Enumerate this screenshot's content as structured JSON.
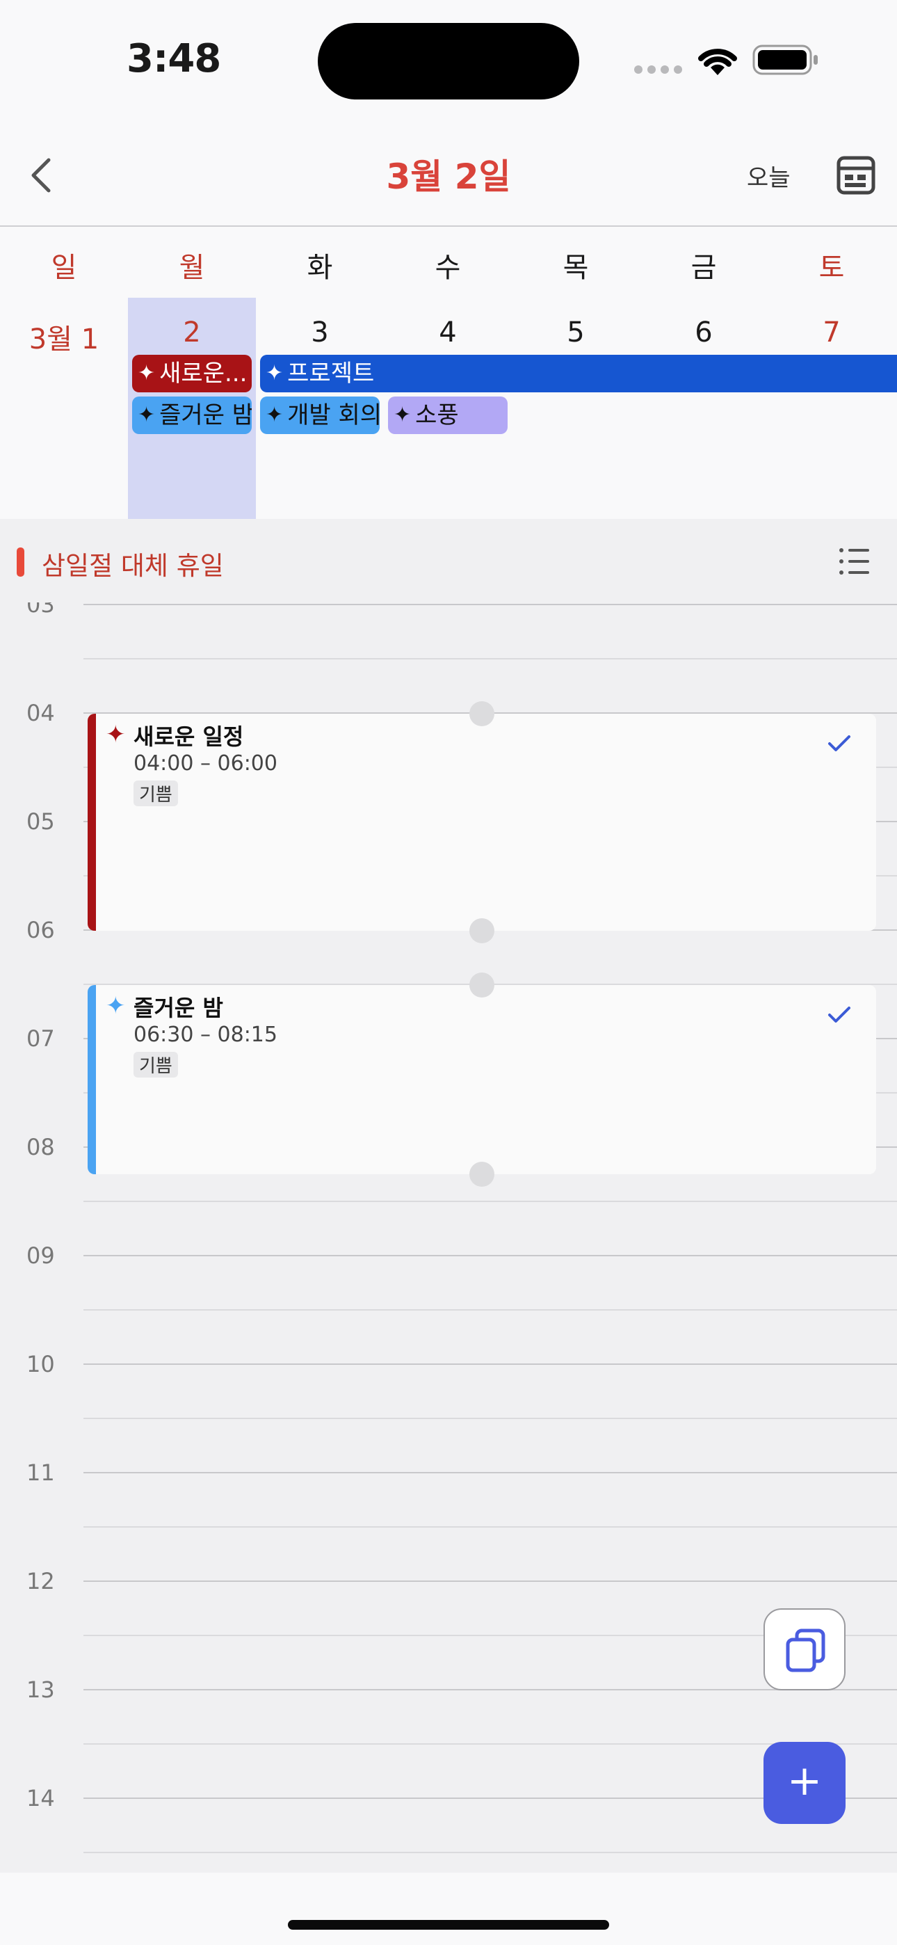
{
  "status_bar": {
    "time": "3:48"
  },
  "header": {
    "title": "3월 2일",
    "today_label": "오늘"
  },
  "week": {
    "weekdays": [
      "일",
      "월",
      "화",
      "수",
      "목",
      "금",
      "토"
    ],
    "days": [
      "3월 1",
      "2",
      "3",
      "4",
      "5",
      "6",
      "7"
    ],
    "selected_index": 1,
    "colors": {
      "sunday_holiday": "#c0392b",
      "selected_bg": "#d4d7f4"
    }
  },
  "week_events": [
    {
      "title": "새로운...",
      "color": "#a81316",
      "text_color": "#ffffff"
    },
    {
      "title": "프로젝트",
      "color": "#1656d1",
      "text_color": "#ffffff"
    },
    {
      "title": "즐거운 밤",
      "color": "#4aa3f2",
      "text_color": "#111111"
    },
    {
      "title": "개발 회의",
      "color": "#4aa3f2",
      "text_color": "#111111"
    },
    {
      "title": "소풍",
      "color": "#b2a8f5",
      "text_color": "#111111"
    }
  ],
  "allday": {
    "holiday": "삼일절 대체 휴일"
  },
  "timeline": {
    "hours": [
      "03",
      "04",
      "05",
      "06",
      "07",
      "08",
      "09",
      "10",
      "11",
      "12",
      "13",
      "14"
    ]
  },
  "events": [
    {
      "title": "새로운 일정",
      "time": "04:00 – 06:00",
      "tag": "기쁨",
      "color": "#a81316"
    },
    {
      "title": "즐거운 밤",
      "time": "06:30 – 08:15",
      "tag": "기쁨",
      "color": "#4aa3f2"
    }
  ],
  "accent": "#4a5ce0"
}
